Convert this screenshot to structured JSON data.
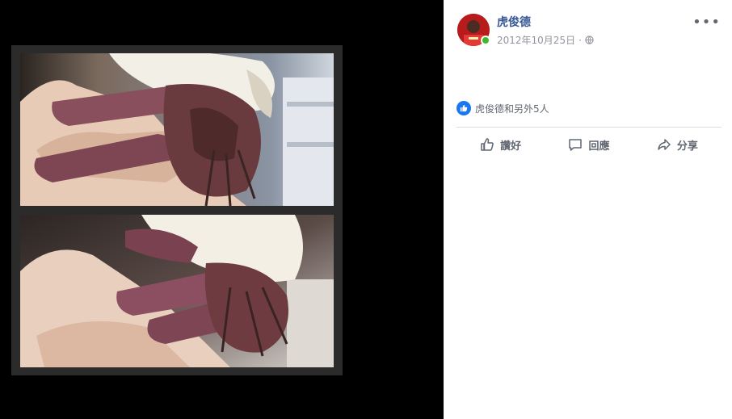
{
  "post": {
    "author": "虎俊德",
    "date": "2012年10月25日",
    "separator": "·",
    "more_label": "•••",
    "reactions_text": "虎俊德和另外5人"
  },
  "actions": {
    "like": "讚好",
    "comment": "回應",
    "share": "分享"
  },
  "colors": {
    "author_link": "#385898",
    "like_badge": "#1877f2",
    "online": "#42b72a"
  },
  "icons": {
    "privacy": "globe-icon",
    "like": "thumbs-up-icon",
    "comment": "speech-bubble-icon",
    "share": "share-arrow-icon"
  }
}
